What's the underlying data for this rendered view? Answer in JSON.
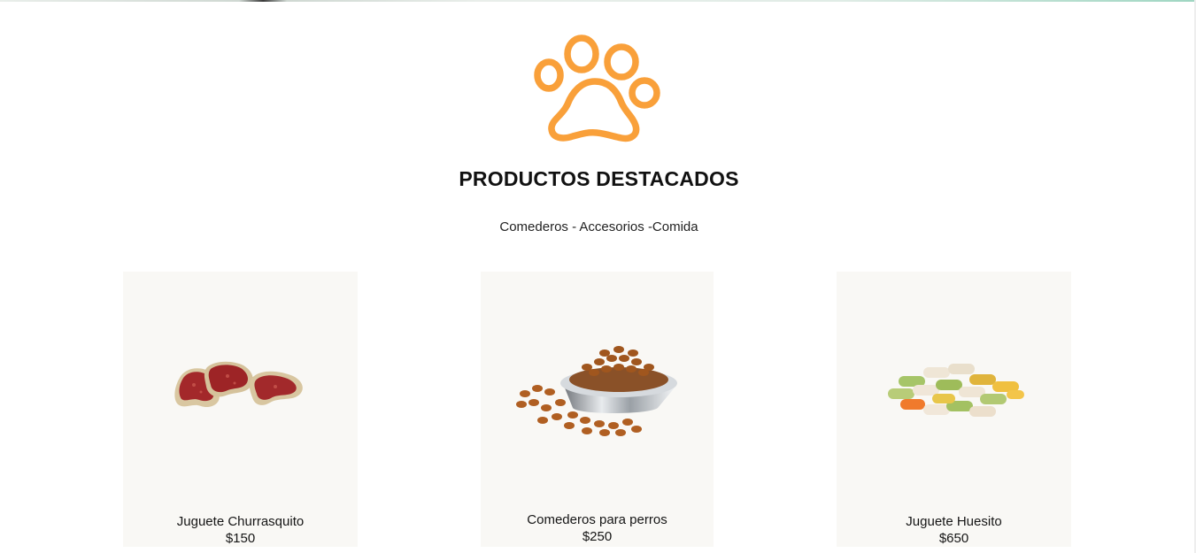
{
  "section": {
    "logo_icon": "paw-icon",
    "title": "PRODUCTOS DESTACADOS",
    "subtitle": "Comederos - Accesorios -Comida"
  },
  "colors": {
    "accent": "#F9A03A",
    "card_background": "#F9F8F5"
  },
  "products": [
    {
      "name": "Juguete Churrasquito",
      "price": "$150",
      "image": "steak-treats-image"
    },
    {
      "name": "Comederos para perros",
      "price": "$250",
      "image": "food-bowl-image"
    },
    {
      "name": "Juguete Huesito",
      "price": "$650",
      "image": "bone-biscuits-image"
    }
  ]
}
